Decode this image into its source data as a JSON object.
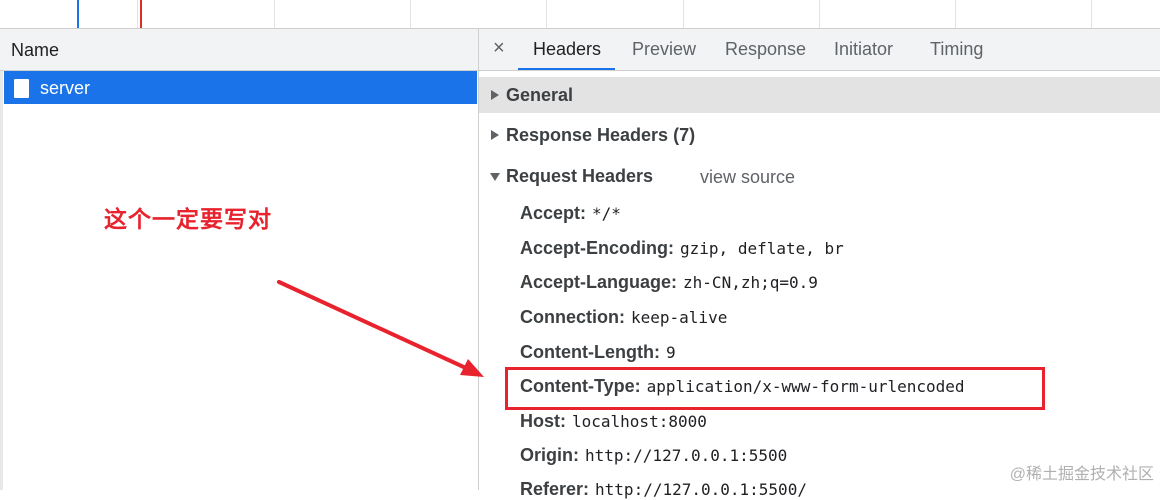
{
  "request_list": {
    "column_header": "Name",
    "requests": [
      {
        "name": "server",
        "selected": true
      }
    ]
  },
  "details": {
    "tabs": [
      "Headers",
      "Preview",
      "Response",
      "Initiator",
      "Timing"
    ],
    "active_tab": "Headers",
    "close_icon": "×",
    "sections": {
      "general": "General",
      "response_headers": "Response Headers (7)",
      "request_headers": "Request Headers",
      "view_source": "view source"
    },
    "request_headers": [
      {
        "name": "Accept:",
        "value": "*/*"
      },
      {
        "name": "Accept-Encoding:",
        "value": "gzip, deflate, br"
      },
      {
        "name": "Accept-Language:",
        "value": "zh-CN,zh;q=0.9"
      },
      {
        "name": "Connection:",
        "value": "keep-alive"
      },
      {
        "name": "Content-Length:",
        "value": "9"
      },
      {
        "name": "Content-Type:",
        "value": "application/x-www-form-urlencoded"
      },
      {
        "name": "Host:",
        "value": "localhost:8000"
      },
      {
        "name": "Origin:",
        "value": "http://127.0.0.1:5500"
      },
      {
        "name": "Referer:",
        "value": "http://127.0.0.1:5500/"
      }
    ]
  },
  "annotation": {
    "text": "这个一定要写对",
    "color": "#e8232e"
  },
  "watermark": "@稀土掘金技术社区",
  "colors": {
    "accent": "#1a73e8",
    "annotation": "#e8232e"
  }
}
